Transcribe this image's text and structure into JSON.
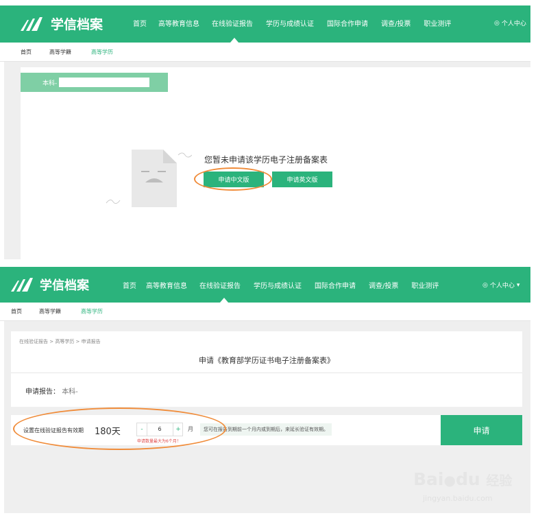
{
  "top": {
    "logo_text": "学信档案",
    "nav": [
      "首页",
      "高等教育信息",
      "在线验证报告",
      "学历与成绩认证",
      "国际合作申请",
      "调查/投票",
      "职业测评"
    ],
    "user_label": "个人中心",
    "subnav": [
      "首页",
      "高等学籍",
      "高等学历"
    ],
    "badge_text": "本科-",
    "empty_message": "您暂未申请该学历电子注册备案表",
    "btn_cn": "申请中文版",
    "btn_en": "申请英文版"
  },
  "bottom": {
    "logo_text": "学信档案",
    "nav": [
      "首页",
      "高等教育信息",
      "在线验证报告",
      "学历与成绩认证",
      "国际合作申请",
      "调查/投票",
      "职业测评"
    ],
    "user_label": "个人中心",
    "subnav": [
      "首页",
      "高等学籍",
      "高等学历"
    ],
    "breadcrumb": "在线验证报告 > 高等学历 > 申请报告",
    "title": "申请《教育部学历证书电子注册备案表》",
    "report_label": "申请报告：",
    "report_value": "本科-",
    "validity_label": "设置在线验证报告有效期",
    "validity_days": "180天",
    "stepper_minus": "-",
    "stepper_value": "6",
    "stepper_plus": "+",
    "unit": "月",
    "hint": "您可在报告到期前一个月内或到期后，来延长验证有效期。",
    "max_note": "申请数量最大为6个月！",
    "apply_button": "申请"
  },
  "watermark": {
    "brand": "Bai",
    "brand2": "du",
    "brand_cn": "经验",
    "url": "jingyan.baidu.com"
  },
  "colors": {
    "brand_green": "#2bb37c",
    "annotation_orange": "#f08c3a",
    "panel_gray": "#efefef"
  }
}
